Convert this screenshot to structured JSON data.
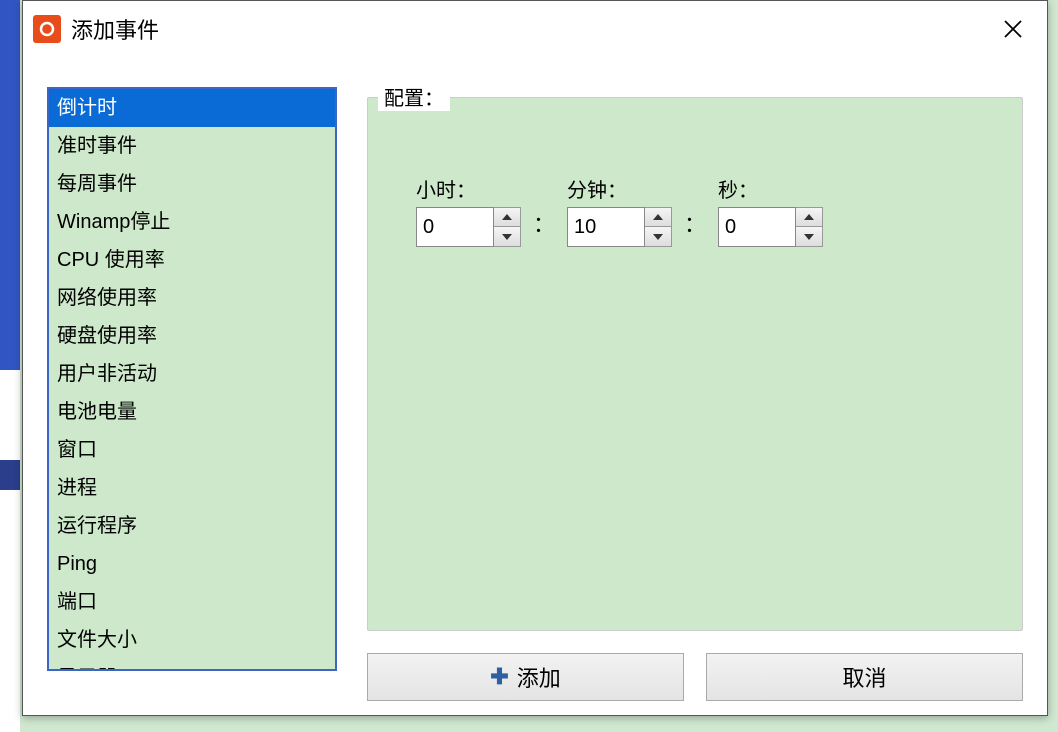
{
  "dialog": {
    "title": "添加事件"
  },
  "list": {
    "items": [
      "倒计时",
      "准时事件",
      "每周事件",
      "Winamp停止",
      "CPU 使用率",
      "网络使用率",
      "硬盘使用率",
      "用户非活动",
      "电池电量",
      "窗口",
      "进程",
      "运行程序",
      "Ping",
      "端口",
      "文件大小",
      "显示器"
    ],
    "selected_index": 0
  },
  "config": {
    "label": "配置：",
    "hours_label": "小时：",
    "minutes_label": "分钟：",
    "seconds_label": "秒：",
    "hours_value": "0",
    "minutes_value": "10",
    "seconds_value": "0"
  },
  "buttons": {
    "add": "添加",
    "cancel": "取消"
  }
}
